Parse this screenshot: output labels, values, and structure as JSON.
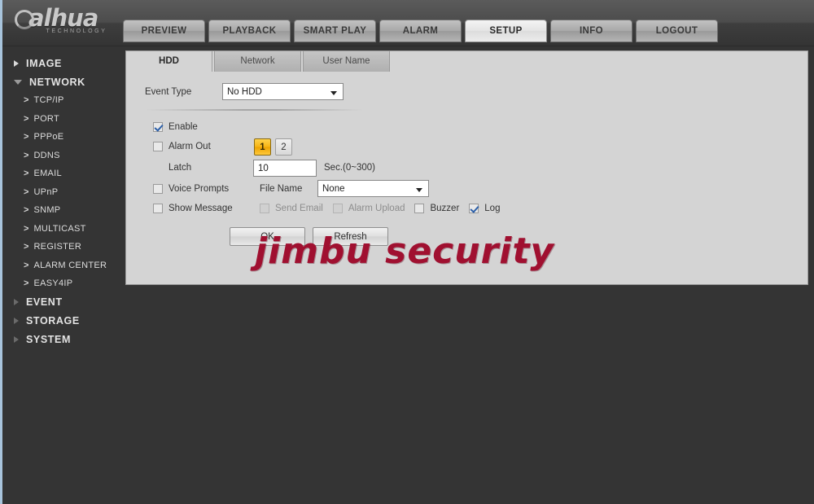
{
  "brand": {
    "name": "alhua",
    "tagline": "TECHNOLOGY"
  },
  "nav": {
    "tabs": [
      {
        "label": "PREVIEW",
        "active": false
      },
      {
        "label": "PLAYBACK",
        "active": false
      },
      {
        "label": "SMART PLAY",
        "active": false
      },
      {
        "label": "ALARM",
        "active": false
      },
      {
        "label": "SETUP",
        "active": true
      },
      {
        "label": "INFO",
        "active": false
      },
      {
        "label": "LOGOUT",
        "active": false
      }
    ]
  },
  "sidebar": {
    "groups": [
      {
        "label": "IMAGE",
        "expanded": false
      },
      {
        "label": "NETWORK",
        "expanded": true
      },
      {
        "label": "EVENT",
        "expanded": false
      },
      {
        "label": "STORAGE",
        "expanded": false
      },
      {
        "label": "SYSTEM",
        "expanded": false
      }
    ],
    "network_items": [
      {
        "label": "TCP/IP"
      },
      {
        "label": "PORT"
      },
      {
        "label": "PPPoE"
      },
      {
        "label": "DDNS"
      },
      {
        "label": "EMAIL"
      },
      {
        "label": "UPnP"
      },
      {
        "label": "SNMP"
      },
      {
        "label": "MULTICAST"
      },
      {
        "label": "REGISTER"
      },
      {
        "label": "ALARM CENTER"
      },
      {
        "label": "EASY4IP"
      }
    ]
  },
  "subtabs": [
    {
      "label": "HDD",
      "active": true
    },
    {
      "label": "Network",
      "active": false
    },
    {
      "label": "User Name",
      "active": false
    }
  ],
  "form": {
    "event_type_label": "Event Type",
    "event_type_value": "No HDD",
    "enable_label": "Enable",
    "enable_checked": true,
    "alarm_out_label": "Alarm Out",
    "alarm_out_checked": false,
    "alarm_out_buttons": [
      {
        "label": "1",
        "selected": true
      },
      {
        "label": "2",
        "selected": false
      }
    ],
    "latch_label": "Latch",
    "latch_value": "10",
    "latch_unit": "Sec.(0~300)",
    "voice_prompts_label": "Voice Prompts",
    "voice_prompts_checked": false,
    "file_name_label": "File Name",
    "file_name_value": "None",
    "show_message_label": "Show Message",
    "show_message_checked": false,
    "send_email_label": "Send Email",
    "send_email_checked": false,
    "send_email_disabled": true,
    "alarm_upload_label": "Alarm Upload",
    "alarm_upload_checked": false,
    "alarm_upload_disabled": true,
    "buzzer_label": "Buzzer",
    "buzzer_checked": false,
    "log_label": "Log",
    "log_checked": true,
    "ok_label": "OK",
    "refresh_label": "Refresh"
  },
  "watermark": {
    "text": "jimbu security",
    "color": "#a01030"
  },
  "colors": {
    "page_background": "#343434",
    "panel_background": "#d4d4d4",
    "accent_orange": "#f6b414",
    "checkbox_check": "#2c5fa8",
    "left_border": "#a8c4dc"
  }
}
